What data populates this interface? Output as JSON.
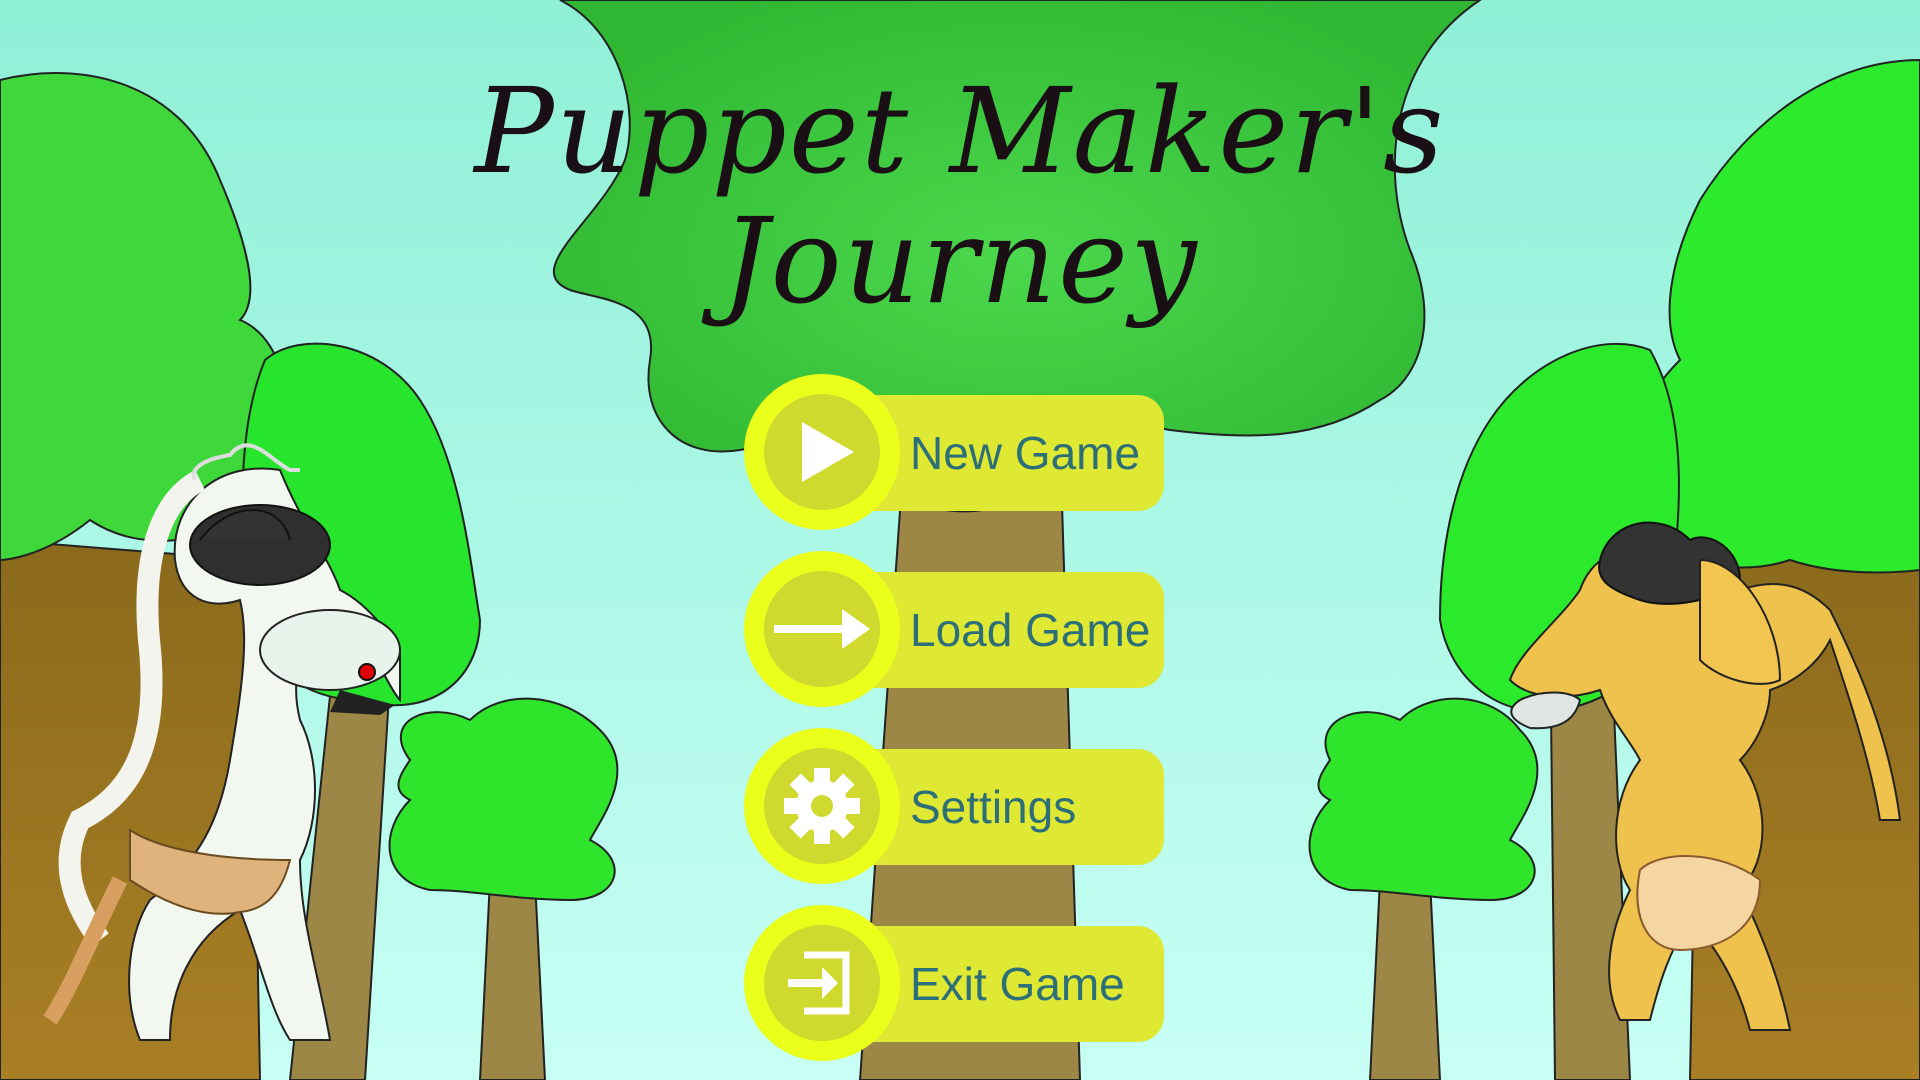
{
  "game": {
    "title_line1": "Puppet Maker's",
    "title_line2": "Journey"
  },
  "menu": {
    "items": [
      {
        "label": "New Game",
        "icon": "play-icon"
      },
      {
        "label": "Load Game",
        "icon": "arrow-right-icon"
      },
      {
        "label": "Settings",
        "icon": "gear-icon"
      },
      {
        "label": "Exit Game",
        "icon": "exit-icon"
      }
    ]
  },
  "colors": {
    "sky_top": "#9ff3d8",
    "sky_bottom": "#c4fff3",
    "canopy": "#3ccf3a",
    "canopy_bright": "#2bea2b",
    "trunk": "#9c8746",
    "button_bar": "#dfe832",
    "button_ring": "#eaff1a",
    "button_text": "#2c6f78"
  }
}
